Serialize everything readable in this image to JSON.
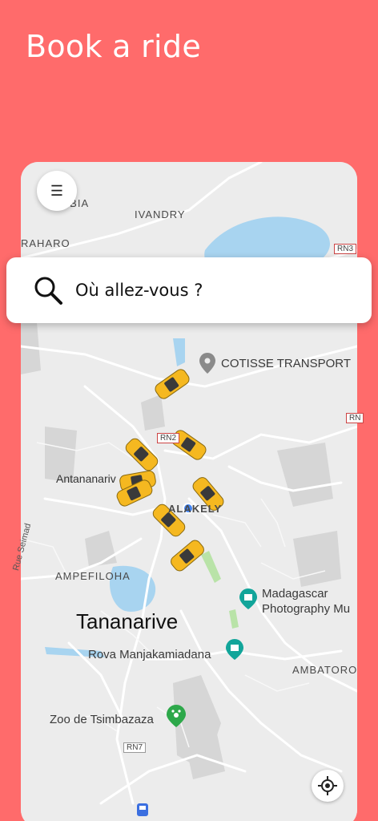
{
  "header": {
    "title": "Book a ride"
  },
  "search": {
    "placeholder": "Où allez-vous ?"
  },
  "map": {
    "labels": {
      "arobia": "AROBIA",
      "ivandry": "IVANDRY",
      "raharo": "RAHARO",
      "cotisse": "COTISSE TRANSPORT",
      "antananarivo": "Antananariv",
      "analakely": "ALAKELY",
      "ampefiloha": "AMPEFILOHA",
      "rue_seimad": "Rue Seimad",
      "tananarive": "Tananarive",
      "madagascar_photo_1": "Madagascar",
      "madagascar_photo_2": "Photography Mu",
      "rova": "Rova Manjakamiadana",
      "ambatoro": "AMBATORO",
      "zoo": "Zoo de Tsimbazaza"
    },
    "road_shields": {
      "rn3": "RN3",
      "rn2": "RN2",
      "rn7": "RN7",
      "rn_edge": "RN"
    }
  },
  "colors": {
    "background": "#FF6B6B",
    "taxi": "#F5B820",
    "user_dot": "#4285F4"
  }
}
